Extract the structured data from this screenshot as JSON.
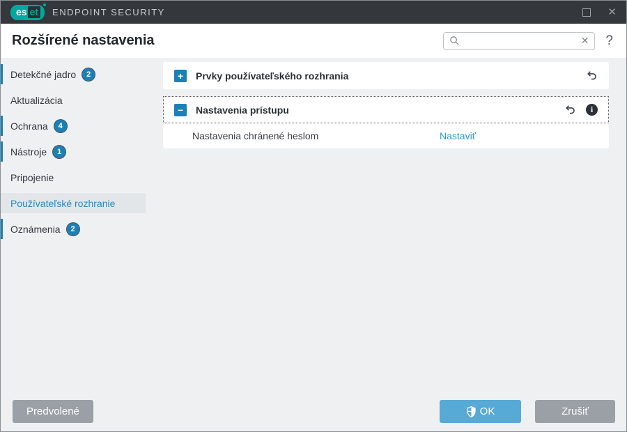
{
  "window": {
    "brand_left": "es",
    "brand_right": "et",
    "product": "ENDPOINT SECURITY"
  },
  "header": {
    "title": "Rozšírené nastavenia",
    "search_value": "",
    "help_label": "?"
  },
  "sidebar": {
    "items": [
      {
        "id": "detekcne-jadro",
        "label": "Detekčné jadro",
        "badge": "2",
        "marked": true,
        "selected": false
      },
      {
        "id": "aktualizacia",
        "label": "Aktualizácia",
        "badge": null,
        "marked": false,
        "selected": false
      },
      {
        "id": "ochrana",
        "label": "Ochrana",
        "badge": "4",
        "marked": true,
        "selected": false
      },
      {
        "id": "nastroje",
        "label": "Nástroje",
        "badge": "1",
        "marked": true,
        "selected": false
      },
      {
        "id": "pripojenie",
        "label": "Pripojenie",
        "badge": null,
        "marked": false,
        "selected": false
      },
      {
        "id": "pouzivatelske-rozhranie",
        "label": "Používateľské rozhranie",
        "badge": null,
        "marked": false,
        "selected": true
      },
      {
        "id": "oznamenia",
        "label": "Oznámenia",
        "badge": "2",
        "marked": true,
        "selected": false
      }
    ]
  },
  "main": {
    "sections": [
      {
        "title": "Prvky používateľského rozhrania",
        "toggle_glyph": "+",
        "expanded": false
      },
      {
        "title": "Nastavenia prístupu",
        "toggle_glyph": "−",
        "expanded": true,
        "info_glyph": "i",
        "rows": [
          {
            "label": "Nastavenia chránené heslom",
            "action": "Nastaviť"
          }
        ]
      }
    ]
  },
  "footer": {
    "default_label": "Predvolené",
    "ok_label": "OK",
    "cancel_label": "Zrušiť"
  },
  "colors": {
    "accent_blue": "#1b80b6",
    "link_blue": "#2d9ad0",
    "ok_blue": "#57a9d6",
    "button_gray": "#9aa0a5",
    "titlebar_bg": "#34373c",
    "eset_teal": "#00a99d",
    "body_bg": "#eef0f2"
  }
}
